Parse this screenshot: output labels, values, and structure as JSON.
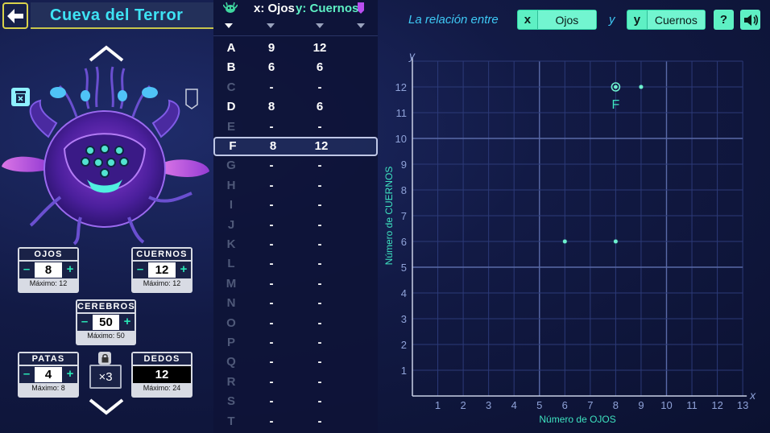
{
  "header": {
    "back_icon": "arrow-left-icon",
    "title": "Cueva del Terror"
  },
  "traits": {
    "ojos": {
      "label": "OJOS",
      "value": "8",
      "max": "Máximo: 12"
    },
    "cuernos": {
      "label": "CUERNOS",
      "value": "12",
      "max": "Máximo: 12"
    },
    "cerebros": {
      "label": "CEREBROS",
      "value": "50",
      "max": "Máximo: 50"
    },
    "patas": {
      "label": "PATAS",
      "value": "4",
      "max": "Máximo: 8"
    },
    "dedos": {
      "label": "DEDOS",
      "value": "12",
      "max": "Máximo: 24"
    },
    "multiplier": "×3",
    "minus": "–",
    "plus": "+"
  },
  "table": {
    "x_header": "x: Ojos",
    "y_header": "y: Cuernos",
    "rows": [
      {
        "l": "A",
        "x": "9",
        "y": "12"
      },
      {
        "l": "B",
        "x": "6",
        "y": "6"
      },
      {
        "l": "C",
        "x": "-",
        "y": "-"
      },
      {
        "l": "D",
        "x": "8",
        "y": "6"
      },
      {
        "l": "E",
        "x": "-",
        "y": "-"
      },
      {
        "l": "F",
        "x": "8",
        "y": "12"
      },
      {
        "l": "G",
        "x": "-",
        "y": "-"
      },
      {
        "l": "H",
        "x": "-",
        "y": "-"
      },
      {
        "l": "I",
        "x": "-",
        "y": "-"
      },
      {
        "l": "J",
        "x": "-",
        "y": "-"
      },
      {
        "l": "K",
        "x": "-",
        "y": "-"
      },
      {
        "l": "L",
        "x": "-",
        "y": "-"
      },
      {
        "l": "M",
        "x": "-",
        "y": "-"
      },
      {
        "l": "N",
        "x": "-",
        "y": "-"
      },
      {
        "l": "O",
        "x": "-",
        "y": "-"
      },
      {
        "l": "P",
        "x": "-",
        "y": "-"
      },
      {
        "l": "Q",
        "x": "-",
        "y": "-"
      },
      {
        "l": "R",
        "x": "-",
        "y": "-"
      },
      {
        "l": "S",
        "x": "-",
        "y": "-"
      },
      {
        "l": "T",
        "x": "-",
        "y": "-"
      }
    ],
    "selected_row": "F"
  },
  "graph": {
    "relation_text": "La relación entre",
    "and_text": "y",
    "x_key": "x",
    "x_value": "Ojos",
    "y_key": "y",
    "y_value": "Cuernos",
    "help_label": "?",
    "sound_icon": "speaker-icon"
  },
  "chart_data": {
    "type": "scatter",
    "xlabel": "Número de OJOS",
    "ylabel": "Número de CUERNOS",
    "x_axis_letter": "x",
    "y_axis_letter": "y",
    "xlim": [
      0,
      13
    ],
    "ylim": [
      0,
      13
    ],
    "xticks": [
      1,
      2,
      3,
      4,
      5,
      6,
      7,
      8,
      9,
      10,
      11,
      12,
      13
    ],
    "yticks": [
      1,
      2,
      3,
      4,
      5,
      6,
      7,
      8,
      9,
      10,
      11,
      12
    ],
    "grid": true,
    "points": [
      {
        "x": 9,
        "y": 12,
        "label": ""
      },
      {
        "x": 6,
        "y": 6,
        "label": ""
      },
      {
        "x": 8,
        "y": 6,
        "label": ""
      },
      {
        "x": 8,
        "y": 12,
        "label": "F",
        "highlighted": true
      }
    ],
    "colors": {
      "point": "#6ef2cf",
      "grid": "#2c3a78",
      "major_grid": "#5a6aa8",
      "label": "#3ee3c0"
    }
  }
}
